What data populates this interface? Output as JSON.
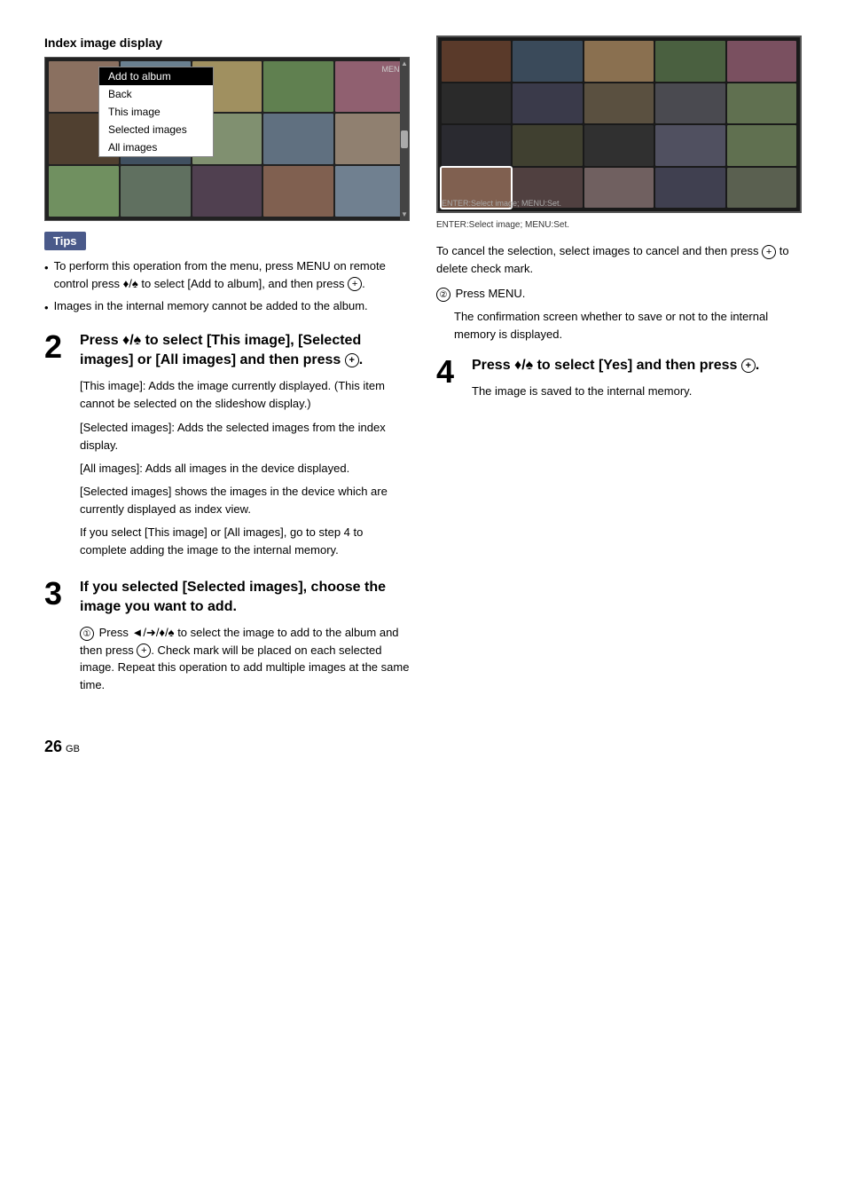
{
  "page": {
    "number": "26",
    "locale": "GB"
  },
  "left": {
    "section_title": "Index image display",
    "dropdown": {
      "items": [
        {
          "label": "Add to album",
          "selected": true
        },
        {
          "label": "Back"
        },
        {
          "label": "This image"
        },
        {
          "label": "Selected images"
        },
        {
          "label": "All images"
        }
      ]
    },
    "menu_label": "MENU",
    "tips_label": "Tips",
    "tips": [
      {
        "text": "To perform this operation from the menu, press MENU on remote control press ♦/♠ to select [Add to album], and then press ⊕."
      },
      {
        "text": "Images in the internal memory cannot be added to the album."
      }
    ],
    "step2": {
      "number": "2",
      "title": "Press ♦/♠ to select [This image], [Selected images] or [All images] and then press ⊕.",
      "paragraphs": [
        "[This image]: Adds the image currently displayed. (This item cannot be selected on the slideshow display.)",
        "[Selected images]: Adds the selected images from the index display.",
        "[All images]: Adds all images in the device displayed.",
        "[Selected images] shows the images in the device which are currently displayed as index view.",
        "If you select [This image] or [All images], go to step 4 to complete adding the image to the internal memory."
      ]
    },
    "step3": {
      "number": "3",
      "title": "If you selected [Selected images], choose the image you want to add.",
      "sub1_label": "①",
      "sub1_text": "Press ◄/➜/♦/♠ to select the image to add to the album and then press ⊕. Check mark will be placed on each selected image. Repeat this operation to add multiple images at the same time.",
      "sub2_label": "②",
      "sub2_cancel_title": "To cancel the selection, select images to cancel and then press ⊕ to delete check mark.",
      "sub2_menu": "②Press MENU.",
      "sub2_menu_body": "The confirmation screen whether to save or not to the internal memory  is displayed."
    }
  },
  "right": {
    "image_caption": "ENTER:Select image; MENU:Set.",
    "step4": {
      "number": "4",
      "title": "Press ♦/♠ to select [Yes] and then press ⊕.",
      "body": "The image is saved to the internal memory."
    }
  }
}
